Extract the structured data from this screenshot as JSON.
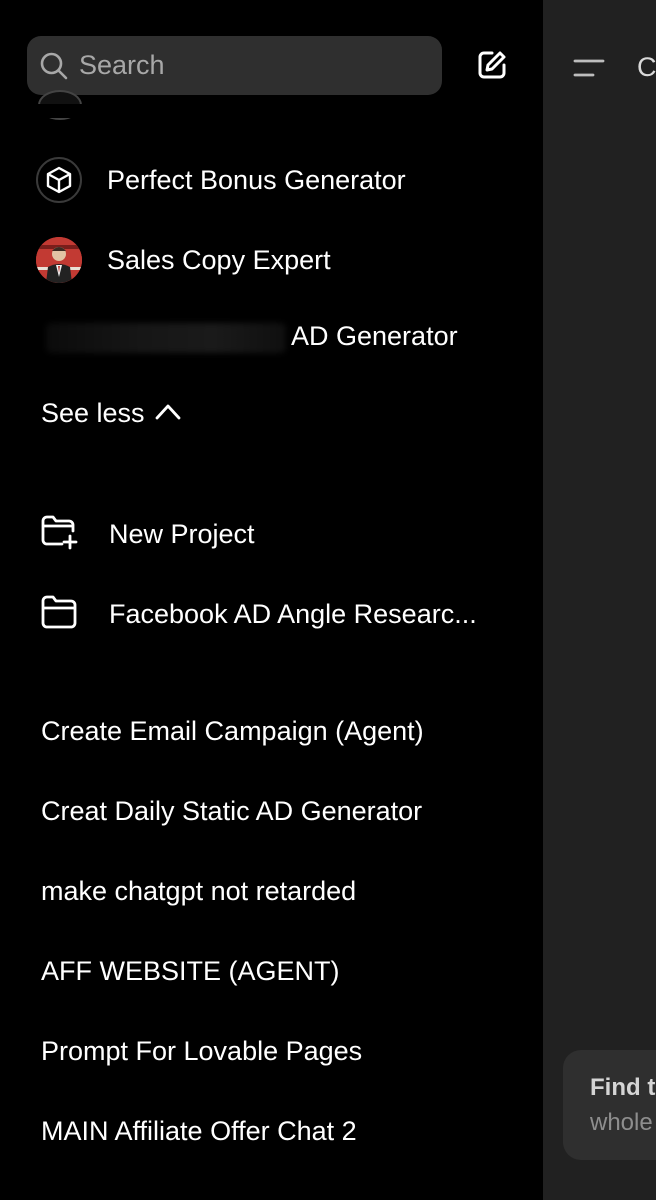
{
  "search": {
    "placeholder": "Search"
  },
  "gpts": [
    {
      "label": "Perfect Bonus Generator",
      "icon": "cube-icon"
    },
    {
      "label": "Sales Copy Expert",
      "icon": "avatar-image"
    }
  ],
  "ad_generator": {
    "visible_label": "AD Generator"
  },
  "see_less": {
    "label": "See less"
  },
  "projects": [
    {
      "label": "New Project",
      "icon": "folder-plus-icon"
    },
    {
      "label": "Facebook AD Angle Researc...",
      "icon": "folder-icon"
    }
  ],
  "chats": [
    "Create Email Campaign (Agent)",
    "Creat Daily Static AD Generator",
    "make chatgpt not retarded",
    "AFF WEBSITE (AGENT)",
    "Prompt For Lovable Pages",
    "MAIN Affiliate Offer Chat 2"
  ],
  "main": {
    "title_fragment": "C",
    "suggestion": {
      "title": "Find t",
      "subtitle": "whole"
    }
  },
  "colors": {
    "sidebar_bg": "#000000",
    "main_bg": "#212121",
    "search_bg": "#2f2f2f",
    "text": "#ffffff",
    "placeholder": "#a8a8a8"
  }
}
